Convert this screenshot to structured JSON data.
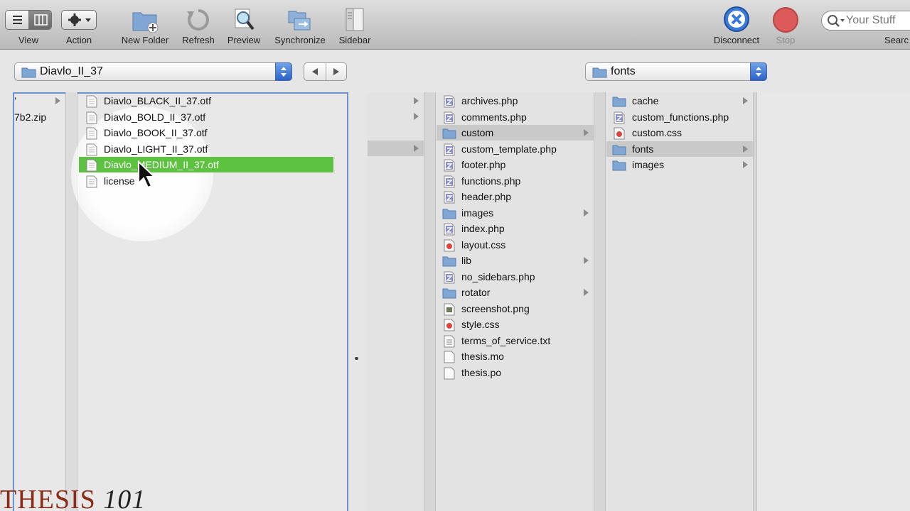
{
  "toolbar": {
    "view_label": "View",
    "action_label": "Action",
    "new_folder_label": "New Folder",
    "refresh_label": "Refresh",
    "preview_label": "Preview",
    "synchronize_label": "Synchronize",
    "sidebar_label": "Sidebar",
    "disconnect_label": "Disconnect",
    "stop_label": "Stop",
    "search_label": "Searc",
    "search_placeholder": "Your Stuff"
  },
  "local_path": {
    "value": "Diavlo_II_37"
  },
  "remote_path": {
    "value": "fonts"
  },
  "left_browser": {
    "partial_column": [
      {
        "name": "’",
        "has_children": true
      },
      {
        "name": "7b2.zip"
      }
    ],
    "files": [
      {
        "name": "Diavlo_BLACK_II_37.otf"
      },
      {
        "name": "Diavlo_BOLD_II_37.otf"
      },
      {
        "name": "Diavlo_BOOK_II_37.otf"
      },
      {
        "name": "Diavlo_LIGHT_II_37.otf"
      },
      {
        "name": "Diavlo_MEDIUM_II_37.otf",
        "selected": true
      },
      {
        "name": "license"
      }
    ]
  },
  "right_browser": {
    "theme_files": [
      {
        "name": "archives.php",
        "type": "php"
      },
      {
        "name": "comments.php",
        "type": "php"
      },
      {
        "name": "custom",
        "type": "folder",
        "selected": true
      },
      {
        "name": "custom_template.php",
        "type": "php"
      },
      {
        "name": "footer.php",
        "type": "php"
      },
      {
        "name": "functions.php",
        "type": "php"
      },
      {
        "name": "header.php",
        "type": "php"
      },
      {
        "name": "images",
        "type": "folder"
      },
      {
        "name": "index.php",
        "type": "php"
      },
      {
        "name": "layout.css",
        "type": "css"
      },
      {
        "name": "lib",
        "type": "folder"
      },
      {
        "name": "no_sidebars.php",
        "type": "php"
      },
      {
        "name": "rotator",
        "type": "folder"
      },
      {
        "name": "screenshot.png",
        "type": "png"
      },
      {
        "name": "style.css",
        "type": "css"
      },
      {
        "name": "terms_of_service.txt",
        "type": "txt"
      },
      {
        "name": "thesis.mo",
        "type": "doc"
      },
      {
        "name": "thesis.po",
        "type": "doc"
      }
    ],
    "custom_files": [
      {
        "name": "cache",
        "type": "folder"
      },
      {
        "name": "custom_functions.php",
        "type": "php"
      },
      {
        "name": "custom.css",
        "type": "css"
      },
      {
        "name": "fonts",
        "type": "folder",
        "selected": true
      },
      {
        "name": "images",
        "type": "folder"
      }
    ]
  },
  "watermark": {
    "main": "THESIS",
    "number": "101"
  },
  "colors": {
    "selection_green": "#5cc23f",
    "selection_gray": "#c9c9c9",
    "folder_blue": "#7fa6d4",
    "brand": "#8a2a18"
  }
}
